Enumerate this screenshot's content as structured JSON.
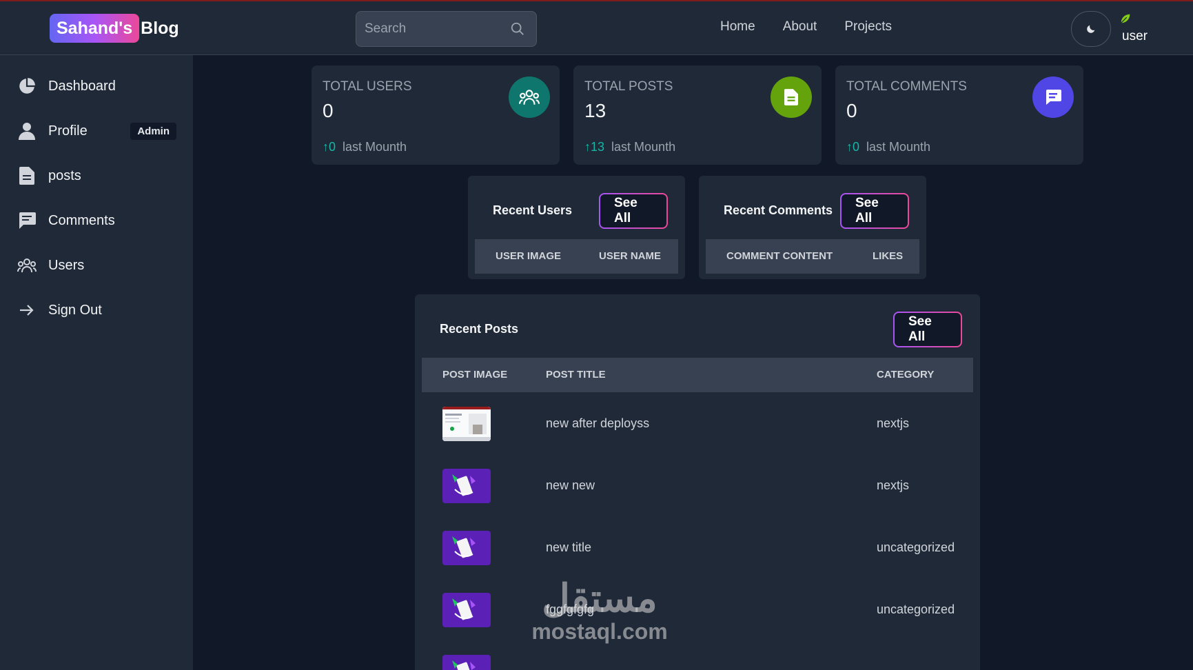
{
  "header": {
    "logo_chip": "Sahand's",
    "logo_text": "Blog",
    "search_placeholder": "Search",
    "nav": [
      "Home",
      "About",
      "Projects"
    ],
    "user_alt": "user"
  },
  "sidebar": {
    "items": [
      {
        "label": "Dashboard",
        "icon": "pie-chart-icon"
      },
      {
        "label": "Profile",
        "icon": "user-icon",
        "badge": "Admin"
      },
      {
        "label": "posts",
        "icon": "document-icon"
      },
      {
        "label": "Comments",
        "icon": "comment-icon"
      },
      {
        "label": "Users",
        "icon": "users-icon"
      },
      {
        "label": "Sign Out",
        "icon": "arrow-right-icon"
      }
    ]
  },
  "stats": [
    {
      "title": "Total Users",
      "value": "0",
      "trend": "0",
      "trend_label": "last Mounth",
      "color": "#0f766e"
    },
    {
      "title": "Total Posts",
      "value": "13",
      "trend": "13",
      "trend_label": "last Mounth",
      "color": "#65a30d"
    },
    {
      "title": "Total Comments",
      "value": "0",
      "trend": "0",
      "trend_label": "last Mounth",
      "color": "#4f46e5"
    }
  ],
  "recent_users": {
    "title": "Recent Users",
    "button": "See All",
    "columns": [
      "User image",
      "User name"
    ]
  },
  "recent_comments": {
    "title": "Recent Comments",
    "button": "See All",
    "columns": [
      "Comment content",
      "Likes"
    ]
  },
  "recent_posts": {
    "title": "Recent Posts",
    "button": "See All",
    "columns": [
      "Post image",
      "Post title",
      "Category"
    ],
    "rows": [
      {
        "title": "new after deployss",
        "category": "nextjs"
      },
      {
        "title": "new new",
        "category": "nextjs"
      },
      {
        "title": "new title",
        "category": "uncategorized"
      },
      {
        "title": "fggfgfgfg",
        "category": "uncategorized"
      },
      {
        "title": "",
        "category": ""
      }
    ]
  },
  "watermark": {
    "arabic": "مستقل",
    "latin": "mostaql.com"
  }
}
